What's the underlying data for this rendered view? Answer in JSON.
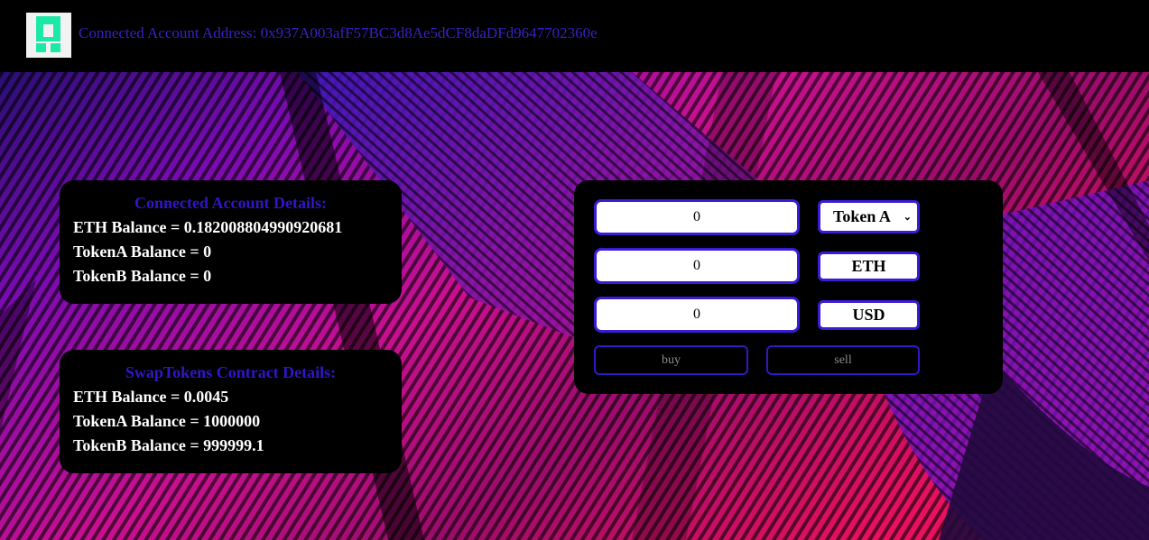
{
  "header": {
    "logo_icon": "logo-icon",
    "address_label": "Connected Account Address:",
    "address": "0x937A003afF57BC3d8Ae5dCF8daDFd9647702360e"
  },
  "account_details": {
    "title": "Connected Account Details:",
    "eth_balance": "ETH Balance = 0.182008804990920681",
    "tokenA_balance": "TokenA Balance = 0",
    "tokenB_balance": "TokenB Balance = 0"
  },
  "contract_details": {
    "title": "SwapTokens Contract Details:",
    "eth_balance": "ETH Balance = 0.0045",
    "tokenA_balance": "TokenA Balance = 1000000",
    "tokenB_balance": "TokenB Balance = 999999.1"
  },
  "swap": {
    "token_amount": "0",
    "token_select": "Token A",
    "eth_amount": "0",
    "eth_label": "ETH",
    "usd_amount": "0",
    "usd_label": "USD",
    "buy_label": "buy",
    "sell_label": "sell"
  },
  "colors": {
    "accent": "#3b1bd6",
    "title_text": "#3215c9",
    "address_text": "#3d1fc4",
    "logo_green": "#1de9a6"
  }
}
